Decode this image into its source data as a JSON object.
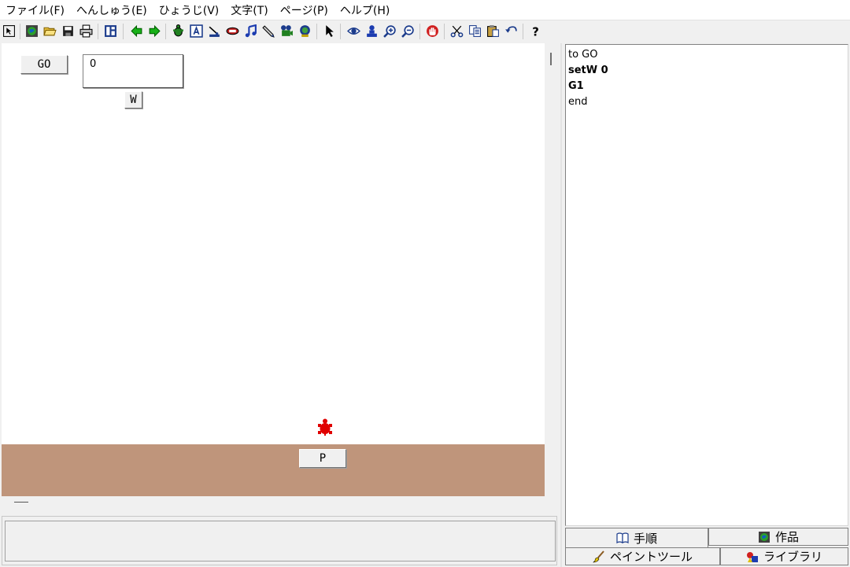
{
  "menu": {
    "items": [
      {
        "id": "file",
        "label": "ファイル(F)"
      },
      {
        "id": "edit",
        "label": "へんしゅう(E)"
      },
      {
        "id": "view",
        "label": "ひょうじ(V)"
      },
      {
        "id": "text",
        "label": "文字(T)"
      },
      {
        "id": "page",
        "label": "ページ(P)"
      },
      {
        "id": "help",
        "label": "ヘルプ(H)"
      }
    ]
  },
  "toolbar": {
    "icons": [
      "select-arrow-icon",
      "project-globe-icon",
      "open-folder-icon",
      "save-disk-icon",
      "print-icon",
      "page-layout-icon",
      "prev-page-icon",
      "next-page-icon",
      "turtle-tool-icon",
      "text-box-icon",
      "slider-tool-icon",
      "button-tool-icon",
      "music-note-icon",
      "pencil-paint-icon",
      "movie-icon",
      "stamp-icon",
      "pointer-icon",
      "eye-icon",
      "stamp-person-icon",
      "zoom-in-icon",
      "zoom-out-icon",
      "stop-hand-icon",
      "scissors-icon",
      "copy-icon",
      "paste-icon",
      "undo-icon",
      "help-question-icon"
    ]
  },
  "canvas": {
    "go_button": "GO",
    "textbox_value": "0",
    "w_button": "W",
    "p_button": "P",
    "ground_color": "#bf957b",
    "turtle_color": "#e00000"
  },
  "editor": {
    "lines": [
      {
        "text": "to GO",
        "bold": false
      },
      {
        "text": "setW 0",
        "bold": true
      },
      {
        "text": "G1",
        "bold": true
      },
      {
        "text": "end",
        "bold": false
      }
    ]
  },
  "tabs": {
    "procedures": "手順",
    "works": "作品",
    "paint_tool": "ペイントツール",
    "library": "ライブラリ"
  }
}
